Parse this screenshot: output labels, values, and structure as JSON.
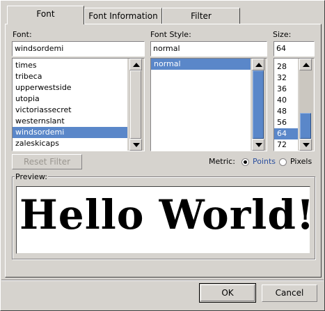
{
  "tabs": [
    {
      "label": "Font",
      "active": true
    },
    {
      "label": "Font Information",
      "active": false
    },
    {
      "label": "Filter",
      "active": false
    }
  ],
  "font": {
    "label": "Font:",
    "value": "windsordemi",
    "items": [
      "times",
      "tribeca",
      "upperwestside",
      "utopia",
      "victoriassecret",
      "westernslant",
      "windsordemi",
      "zaleskicaps"
    ],
    "selected": "windsordemi"
  },
  "style": {
    "label": "Font Style:",
    "value": "normal",
    "items": [
      "normal"
    ],
    "selected": "normal"
  },
  "size": {
    "label": "Size:",
    "value": "64",
    "items": [
      "28",
      "32",
      "36",
      "40",
      "48",
      "56",
      "64",
      "72"
    ],
    "selected": "64"
  },
  "reset_filter": "Reset Filter",
  "metric": {
    "label": "Metric:",
    "options": [
      {
        "label": "Points",
        "checked": true
      },
      {
        "label": "Pixels",
        "checked": false
      }
    ]
  },
  "preview": {
    "label": "Preview:",
    "text": "Hello World!"
  },
  "buttons": {
    "ok": "OK",
    "cancel": "Cancel"
  }
}
